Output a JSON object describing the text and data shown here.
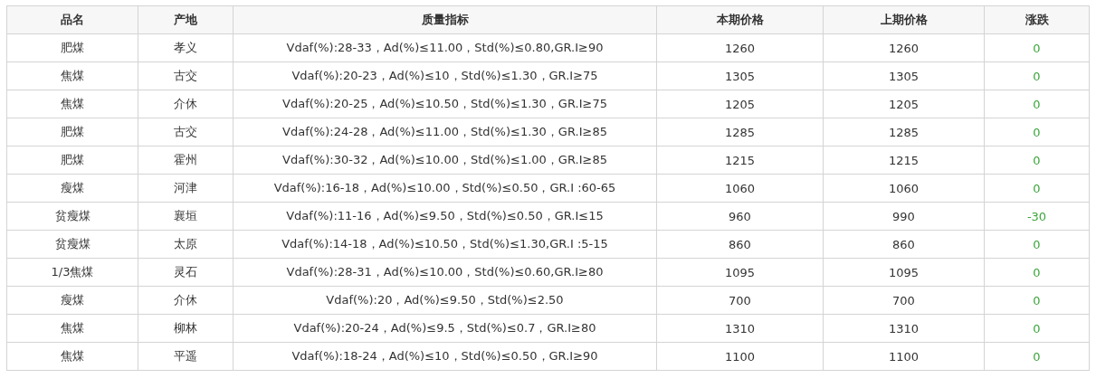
{
  "table": {
    "columns": [
      "品名",
      "产地",
      "质量指标",
      "本期价格",
      "上期价格",
      "涨跌"
    ],
    "rows": [
      [
        "肥煤",
        "孝义",
        "Vdaf(%):28-33，Ad(%)≤11.00，Std(%)≤0.80,GR.I≥90",
        "1260",
        "1260",
        "0"
      ],
      [
        "焦煤",
        "古交",
        "Vdaf(%):20-23，Ad(%)≤10，Std(%)≤1.30，GR.I≥75",
        "1305",
        "1305",
        "0"
      ],
      [
        "焦煤",
        "介休",
        "Vdaf(%):20-25，Ad(%)≤10.50，Std(%)≤1.30，GR.I≥75",
        "1205",
        "1205",
        "0"
      ],
      [
        "肥煤",
        "古交",
        "Vdaf(%):24-28，Ad(%)≤11.00，Std(%)≤1.30，GR.I≥85",
        "1285",
        "1285",
        "0"
      ],
      [
        "肥煤",
        "霍州",
        "Vdaf(%):30-32，Ad(%)≤10.00，Std(%)≤1.00，GR.I≥85",
        "1215",
        "1215",
        "0"
      ],
      [
        "瘦煤",
        "河津",
        "Vdaf(%):16-18，Ad(%)≤10.00，Std(%)≤0.50，GR.I :60-65",
        "1060",
        "1060",
        "0"
      ],
      [
        "贫瘦煤",
        "襄垣",
        "Vdaf(%):11-16，Ad(%)≤9.50，Std(%)≤0.50，GR.I≤15",
        "960",
        "990",
        "-30"
      ],
      [
        "贫瘦煤",
        "太原",
        "Vdaf(%):14-18，Ad(%)≤10.50，Std(%)≤1.30,GR.I :5-15",
        "860",
        "860",
        "0"
      ],
      [
        "1/3焦煤",
        "灵石",
        "Vdaf(%):28-31，Ad(%)≤10.00，Std(%)≤0.60,GR.I≥80",
        "1095",
        "1095",
        "0"
      ],
      [
        "瘦煤",
        "介休",
        "Vdaf(%):20，Ad(%)≤9.50，Std(%)≤2.50",
        "700",
        "700",
        "0"
      ],
      [
        "焦煤",
        "柳林",
        "Vdaf(%):20-24，Ad(%)≤9.5，Std(%)≤0.7，GR.I≥80",
        "1310",
        "1310",
        "0"
      ],
      [
        "焦煤",
        "平遥",
        "Vdaf(%):18-24，Ad(%)≤10，Std(%)≤0.50，GR.I≥90",
        "1100",
        "1100",
        "0"
      ]
    ]
  }
}
